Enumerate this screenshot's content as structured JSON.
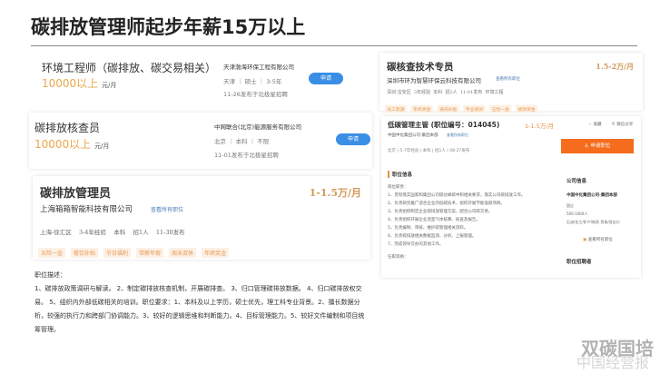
{
  "title": "碳排放管理师起步年薪15万以上",
  "jobs": [
    {
      "title": "环境工程师（碳排放、碳交易相关）",
      "salary": "10000以上",
      "unit": "元/月",
      "company": "天津渤海环保工程有限公司",
      "meta": "天津 ｜ 硕士 ｜ 3-5年",
      "posted": "11-26发布于北极星招聘",
      "apply": "申请"
    },
    {
      "title": "碳排放核查员",
      "salary": "10000以上",
      "unit": "元/月",
      "company": "中网联合(北京)能源服务有限公司",
      "meta": "北京 ｜ 本科 ｜ 不限",
      "posted": "11-01发布于北极星招聘",
      "apply": "申请"
    }
  ],
  "manager": {
    "title": "碳排放管理员",
    "salary": "1-1.5万/月",
    "company": "上海箱箱智能科技有限公司",
    "view_all": "查看所有职位",
    "meta": [
      "上海-徐汇区",
      "3-4年经验",
      "本科",
      "招1人",
      "11-30发布"
    ],
    "tags": [
      "五险一金",
      "餐饮补贴",
      "节日福利",
      "带薪年假",
      "周末双休",
      "年终奖金"
    ]
  },
  "description": {
    "heading": "职位描述：",
    "body": "1、碳排放政策调研与解读。 2、制定碳排放核查机制，开展碳排查。 3、归口管理碳排放数据。 4、归口碳排放权交易。 5、组织内外部低碳相关的培训。职位要求：1、本科及以上学历，硕士优先，理工科专业背景。2、擅长数据分析，较强的执行力和跨部门协调能力。3、较好的逻辑思维和判断能力。4、目标管理能力。5、较好文件编制和项目统筹管理。"
  },
  "verifier": {
    "title": "碳核查技术专员",
    "salary": "1.5-2万/月",
    "company": "深圳市环为智慧环保云科技有限公司",
    "view_all": "查看所有职位",
    "meta": [
      "深圳-宝安区",
      "3年经验",
      "本科",
      "招2人",
      "11-01发布",
      "环境工程"
    ],
    "tags": [
      "员工旅游",
      "年终奖金",
      "通讯补贴",
      "专业培训",
      "五险一金",
      "绩效奖金"
    ]
  },
  "detail": {
    "title": "低碳管理主管 (职位编号：014045)",
    "salary": "1-1.5万/月",
    "company": "中国中化集团公司-集团本部",
    "view_all": "查看所有职位",
    "meta": "北京 | 5-7年经验 | 本科 | 招1人 | 08-27发布",
    "collect": "收藏",
    "share": "微信分享",
    "apply": "申请职位",
    "section": "职位信息",
    "company_section": "公司信息",
    "company_name": "中国中化集团公司-集团本部",
    "company_info": [
      "国企",
      "500-1000人",
      "石油/化工/矿产/地质 贸易/进出口"
    ],
    "view_jobs": "查看所有职位",
    "recruiter": "职位招聘者",
    "lines": [
      "岗位职责：",
      "1、贯彻落实国家和集团公司碳达峰碳中和相关要求，落实公司碳排放工作。",
      "2、负责研究推广适合企业的低碳技术，组织开展节能低碳项目。",
      "3、负责组织制定企业碳排放管理方案，配合公司碳交易。",
      "4、负责组织开展企业温室气体核算、核查及报告。",
      "5、负责编制、审核、维护碳管理相关资料。",
      "6、负责碳排放相关数据监测、分析、上报管理。",
      "7、完成领导交办的其他工作。",
      "任职资格："
    ]
  },
  "watermark": {
    "line1": "双碳国培",
    "line2": "中国经营报"
  }
}
